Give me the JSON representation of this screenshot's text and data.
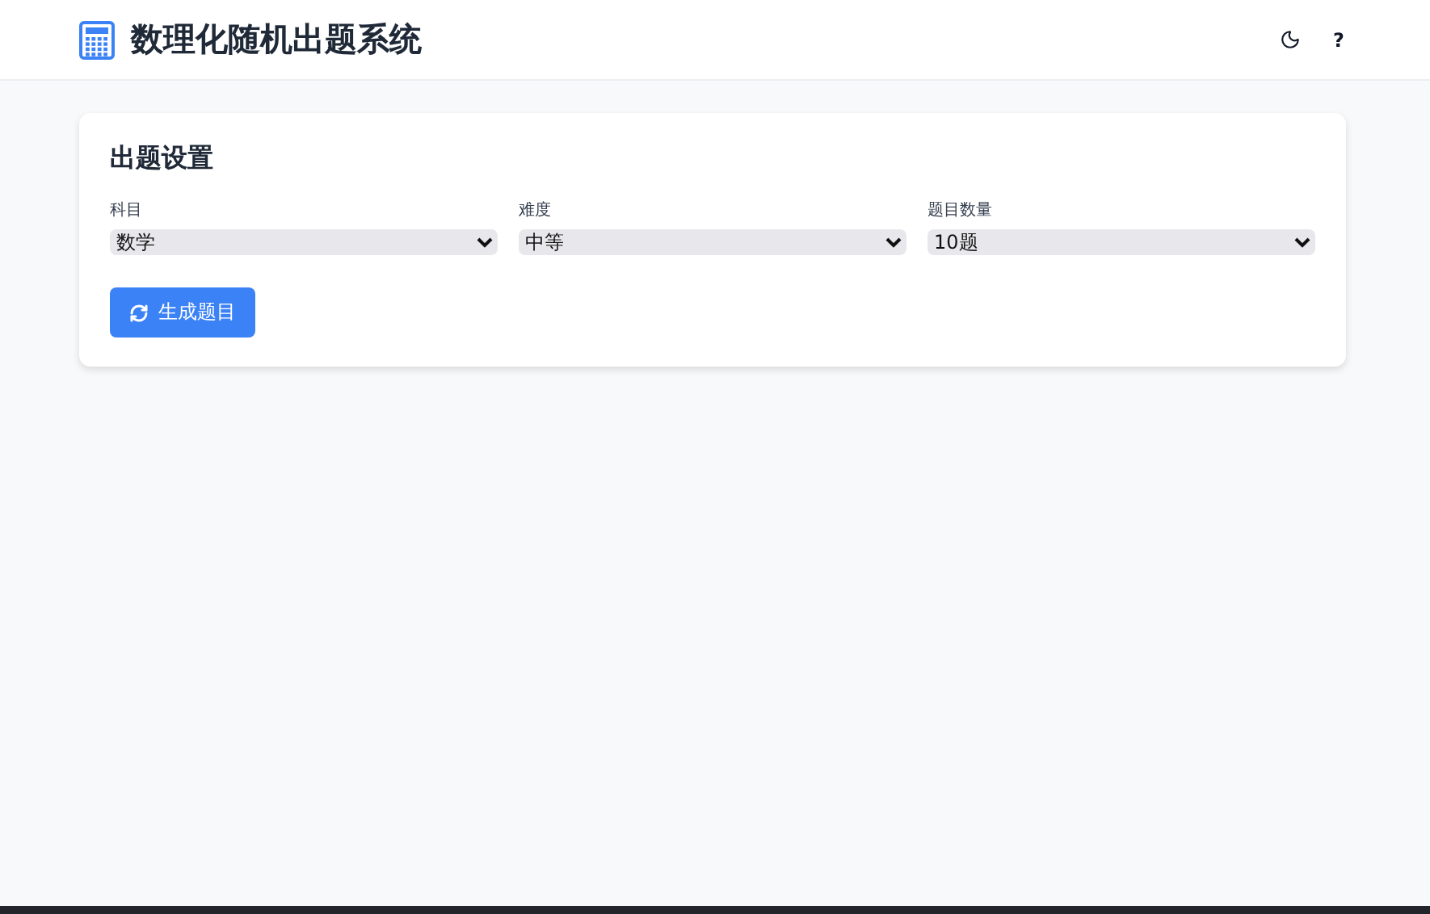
{
  "header": {
    "title": "数理化随机出题系统",
    "help_button": "?"
  },
  "settings": {
    "title": "出题设置",
    "fields": [
      {
        "label": "科目",
        "value": "数学"
      },
      {
        "label": "难度",
        "value": "中等"
      },
      {
        "label": "题目数量",
        "value": "10题"
      }
    ],
    "generate_button": "生成题目"
  }
}
